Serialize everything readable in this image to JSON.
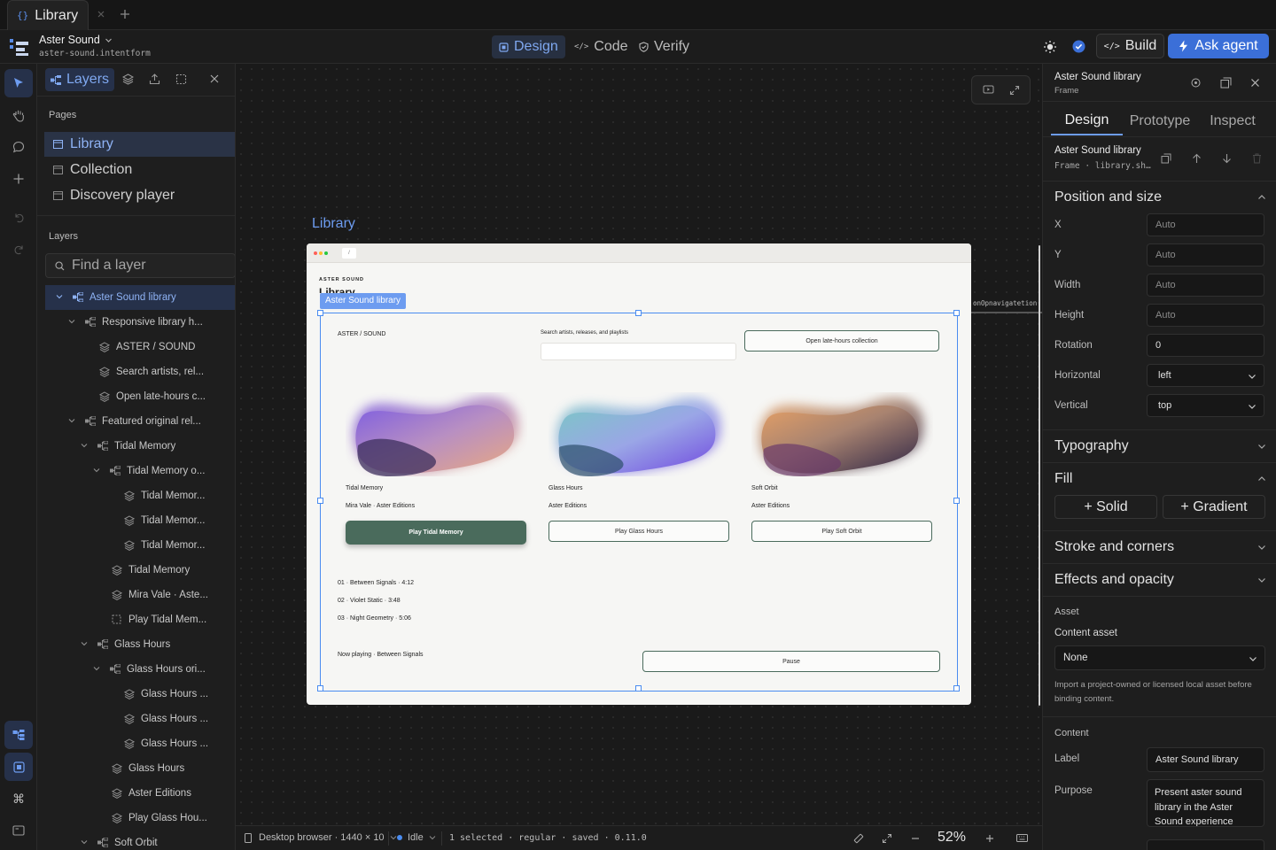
{
  "tabbar": {
    "tab_title": "Library"
  },
  "project": {
    "name": "Aster Sound",
    "id": "aster-sound.intentform"
  },
  "modes": {
    "design": "Design",
    "code": "Code",
    "verify": "Verify"
  },
  "actions": {
    "build": "Build",
    "ask_agent": "Ask agent"
  },
  "left_panel": {
    "tab_layers": "Layers",
    "pages_title": "Pages",
    "pages": [
      "Library",
      "Collection",
      "Discovery player"
    ],
    "layers_title": "Layers",
    "search_placeholder": "Find a layer",
    "layers": [
      {
        "label": "Aster Sound library"
      },
      {
        "label": "Responsive library h..."
      },
      {
        "label": "ASTER / SOUND"
      },
      {
        "label": "Search artists, rel..."
      },
      {
        "label": "Open late-hours c..."
      },
      {
        "label": "Featured original rel..."
      },
      {
        "label": "Tidal Memory"
      },
      {
        "label": "Tidal Memory o..."
      },
      {
        "label": "Tidal Memor..."
      },
      {
        "label": "Tidal Memor..."
      },
      {
        "label": "Tidal Memor..."
      },
      {
        "label": "Tidal Memory"
      },
      {
        "label": "Mira Vale · Aste..."
      },
      {
        "label": "Play Tidal Mem..."
      },
      {
        "label": "Glass Hours"
      },
      {
        "label": "Glass Hours ori..."
      },
      {
        "label": "Glass Hours ..."
      },
      {
        "label": "Glass Hours ..."
      },
      {
        "label": "Glass Hours ..."
      },
      {
        "label": "Glass Hours"
      },
      {
        "label": "Aster Editions"
      },
      {
        "label": "Play Glass Hou..."
      },
      {
        "label": "Soft Orbit"
      }
    ]
  },
  "canvas": {
    "frame_label": "Library",
    "selection_label": "Aster Sound library",
    "connector_label": "onOpnavigatetion",
    "browser_url": "/",
    "header_kicker": "ASTER SOUND",
    "header_title": "Library",
    "brand": "ASTER / SOUND",
    "search_label": "Search artists, releases, and playlists",
    "open_collection": "Open late-hours collection",
    "cards": [
      {
        "title": "Tidal Memory",
        "artist": "Mira Vale · Aster Editions",
        "button": "Play Tidal Memory"
      },
      {
        "title": "Glass Hours",
        "artist": "Aster Editions",
        "button": "Play Glass Hours"
      },
      {
        "title": "Soft Orbit",
        "artist": "Aster Editions",
        "button": "Play Soft Orbit"
      }
    ],
    "tracks": [
      "01 · Between Signals · 4:12",
      "02 · Violet Static · 3:48",
      "03 · Night Geometry · 5:06"
    ],
    "now_playing": "Now playing · Between Signals",
    "pause": "Pause"
  },
  "statusbar": {
    "device": "Desktop browser · 1440 × 10",
    "state": "Idle",
    "info": "1 selected · regular · saved · 0.11.0",
    "zoom": "52%"
  },
  "right_panel": {
    "title": "Aster Sound library",
    "subtitle": "Frame",
    "tabs": [
      "Design",
      "Prototype",
      "Inspect"
    ],
    "node_name": "Aster Sound library",
    "node_meta": "Frame · library.sh…",
    "position_title": "Position and size",
    "fields": [
      {
        "label": "X",
        "value": "Auto"
      },
      {
        "label": "Y",
        "value": "Auto"
      },
      {
        "label": "Width",
        "value": "Auto"
      },
      {
        "label": "Height",
        "value": "Auto"
      },
      {
        "label": "Rotation",
        "value": "0"
      }
    ],
    "horizontal_label": "Horizontal",
    "horizontal_value": "left",
    "vertical_label": "Vertical",
    "vertical_value": "top",
    "typography_title": "Typography",
    "fill_title": "Fill",
    "fill_solid": "+ Solid",
    "fill_gradient": "+ Gradient",
    "stroke_title": "Stroke and corners",
    "effects_title": "Effects and opacity",
    "asset_title": "Asset",
    "content_asset_label": "Content asset",
    "content_asset_value": "None",
    "asset_help": "Import a project-owned or licensed local asset before binding content.",
    "content_title": "Content",
    "label_label": "Label",
    "label_value": "Aster Sound library",
    "purpose_label": "Purpose",
    "purpose_value": "Present aster sound library in the Aster Sound experience"
  },
  "colors": {
    "accent": "#3b6fd8",
    "selection": "#4a8cf0",
    "primary_button": "#4a6b5c"
  }
}
